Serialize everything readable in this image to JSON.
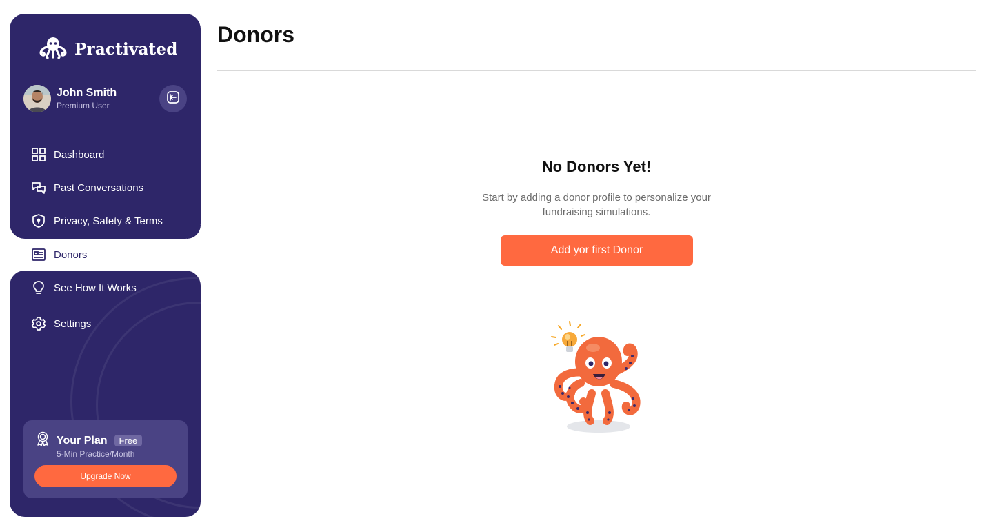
{
  "app": {
    "brand": "Practivated"
  },
  "user": {
    "name": "John Smith",
    "role": "Premium User"
  },
  "nav": {
    "items": [
      {
        "label": "Dashboard",
        "icon": "grid-icon"
      },
      {
        "label": "Past Conversations",
        "icon": "chat-icon"
      },
      {
        "label": "Privacy, Safety & Terms",
        "icon": "shield-icon"
      },
      {
        "label": "Donors",
        "icon": "id-card-icon",
        "active": true
      },
      {
        "label": "See How It Works",
        "icon": "lightbulb-icon"
      },
      {
        "label": "Settings",
        "icon": "gear-icon"
      }
    ]
  },
  "plan": {
    "title": "Your Plan",
    "badge": "Free",
    "subtitle": "5-Min Practice/Month",
    "button": "Upgrade Now"
  },
  "main": {
    "title": "Donors",
    "empty_title": "No Donors Yet!",
    "empty_desc": "Start by adding a donor profile to personalize your fundraising simulations.",
    "cta": "Add yor first Donor"
  },
  "colors": {
    "sidebar": "#2e2669",
    "accent": "#ff6940",
    "card": "#4a4384"
  }
}
